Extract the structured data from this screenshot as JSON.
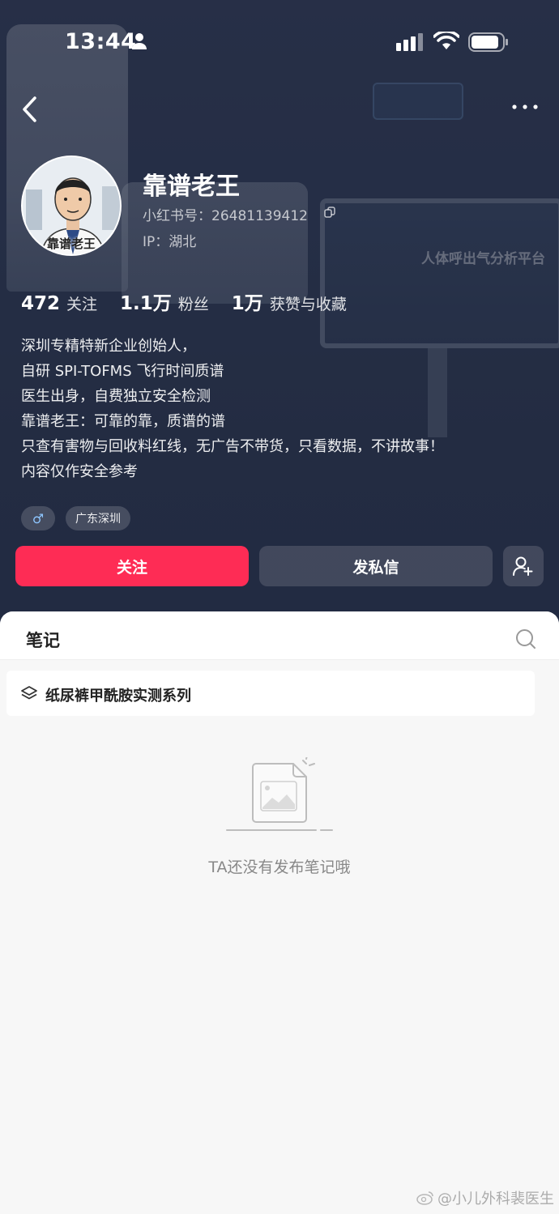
{
  "status_bar": {
    "time": "13:44"
  },
  "profile": {
    "nickname": "靠谱老王",
    "avatar_caption": "靠谱老王",
    "user_id": "小红书号：26481139412",
    "ip_location": "IP：湖北"
  },
  "background": {
    "monitor_title": "人体呼出气分析平台"
  },
  "stats": [
    {
      "num": "472",
      "label": "关注"
    },
    {
      "num": "1.1万",
      "label": "粉丝"
    },
    {
      "num": "1万",
      "label": "获赞与收藏"
    }
  ],
  "bio": [
    "深圳专精特新企业创始人，",
    "自研 SPI-TOFMS 飞行时间质谱",
    "医生出身，自费独立安全检测",
    "靠谱老王：可靠的靠，质谱的谱",
    "只查有害物与回收料红线，无广告不带货，只看数据，不讲故事！",
    "内容仅作安全参考"
  ],
  "tags": {
    "gender": "♂",
    "location": "广东深圳"
  },
  "actions": {
    "follow": "关注",
    "message": "发私信"
  },
  "tabs": {
    "notes": "笔记"
  },
  "collection": {
    "label": "纸尿裤甲酰胺实测系列"
  },
  "empty_state": {
    "text": "TA还没有发布笔记哦"
  },
  "watermark": {
    "text": "@小儿外科裴医生"
  },
  "colors": {
    "accent": "#fe2c55",
    "hero_bg": "#2a3550"
  }
}
